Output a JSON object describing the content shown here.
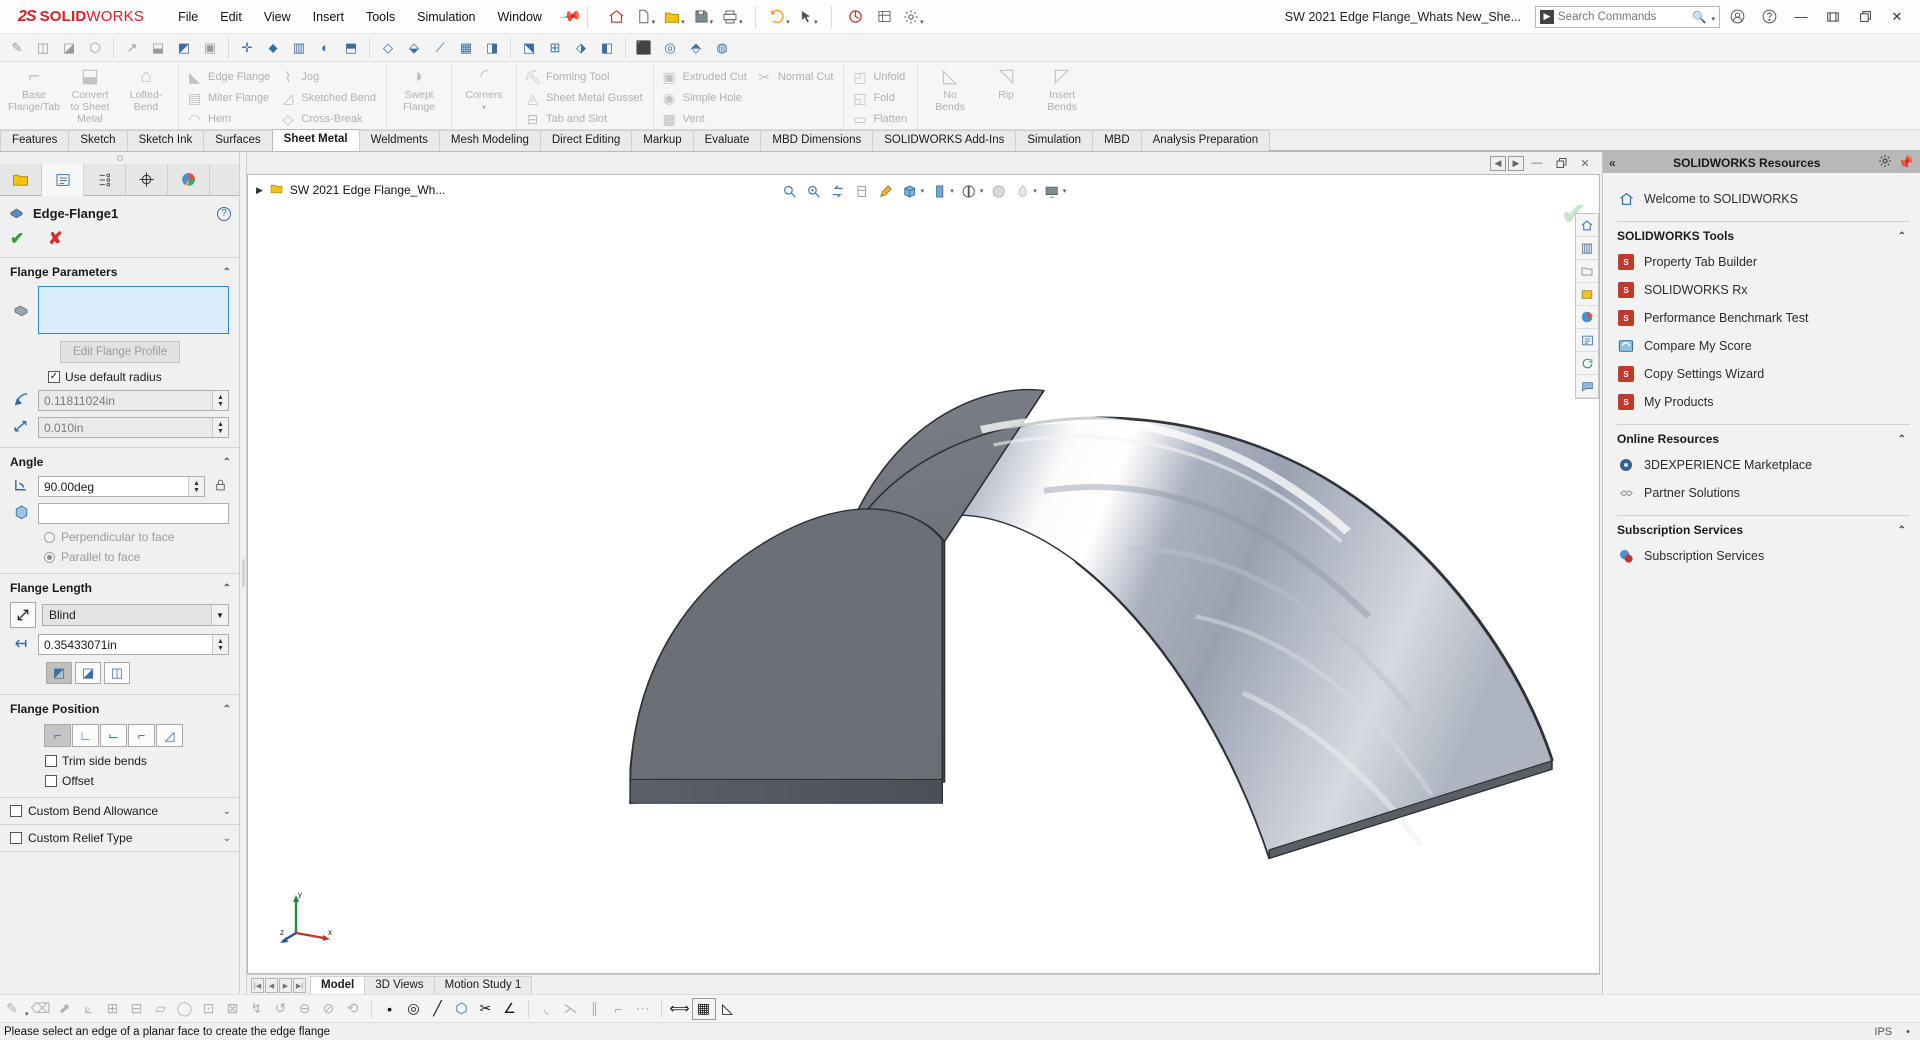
{
  "titlebar": {
    "brand_ds": "2S",
    "brand_solid": "SOLID",
    "brand_works": "WORKS",
    "menus": [
      "File",
      "Edit",
      "View",
      "Insert",
      "Tools",
      "Simulation",
      "Window"
    ],
    "doc_title": "SW 2021 Edge Flange_Whats New_She...",
    "search_placeholder": "Search Commands",
    "icons": [
      "home-icon",
      "new-doc-icon",
      "open-folder-icon",
      "save-icon",
      "print-icon",
      "undo-icon",
      "redo-icon",
      "select-icon",
      "rebuild-icon",
      "options-gear-icon"
    ]
  },
  "ribbon": {
    "groups": [
      {
        "name": "base-group",
        "big": [
          {
            "label": "Base\nFlange/Tab",
            "icon": "base-flange-icon"
          },
          {
            "label": "Convert\nto Sheet\nMetal",
            "icon": "convert-sheet-metal-icon"
          },
          {
            "label": "Lofted-Bend",
            "icon": "lofted-bend-icon"
          }
        ],
        "small": []
      },
      {
        "name": "flange-group",
        "big": [],
        "small": [
          "Edge Flange",
          "Miter Flange",
          "Hem"
        ]
      },
      {
        "name": "bend-group",
        "big": [],
        "small": [
          "Jog",
          "Sketched Bend",
          "Cross-Break"
        ]
      },
      {
        "name": "swept-group",
        "big": [
          {
            "label": "Swept\nFlange",
            "icon": "swept-flange-icon"
          }
        ],
        "small": []
      },
      {
        "name": "corners-group",
        "big": [
          {
            "label": "Corners",
            "icon": "corners-icon"
          }
        ],
        "small": []
      },
      {
        "name": "forming-group",
        "big": [],
        "small": [
          "Forming Tool",
          "Sheet Metal Gusset",
          "Tab and Slot"
        ]
      },
      {
        "name": "cut-group",
        "big": [],
        "small": [
          "Extruded Cut",
          "Simple Hole",
          "Vent"
        ]
      },
      {
        "name": "cut2-group",
        "big": [],
        "small": [
          "Normal Cut"
        ]
      },
      {
        "name": "unfold-group",
        "big": [],
        "small": [
          "Unfold",
          "Fold",
          "Flatten"
        ]
      },
      {
        "name": "bends-group",
        "big": [
          {
            "label": "No\nBends",
            "icon": "no-bends-icon"
          },
          {
            "label": "Rip",
            "icon": "rip-icon"
          },
          {
            "label": "Insert\nBends",
            "icon": "insert-bends-icon"
          }
        ],
        "small": []
      }
    ]
  },
  "tabs": {
    "items": [
      "Features",
      "Sketch",
      "Sketch Ink",
      "Surfaces",
      "Sheet Metal",
      "Weldments",
      "Mesh Modeling",
      "Direct Editing",
      "Markup",
      "Evaluate",
      "MBD Dimensions",
      "SOLIDWORKS Add-Ins",
      "Simulation",
      "MBD",
      "Analysis Preparation"
    ],
    "active": "Sheet Metal"
  },
  "property_manager": {
    "title": "Edge-Flange1",
    "icon": "edge-flange-icon",
    "sections": {
      "flange_parameters": {
        "heading": "Flange Parameters",
        "selection_value": "",
        "edit_profile_button": "Edit Flange Profile",
        "use_default_radius_label": "Use default radius",
        "use_default_radius_checked": true,
        "radius_value": "0.11811024in",
        "thickness_value": "0.010in"
      },
      "angle": {
        "heading": "Angle",
        "angle_value": "90.00deg",
        "reference_face_value": "",
        "perpendicular_label": "Perpendicular to face",
        "parallel_label": "Parallel to face",
        "selected_option": "Parallel to face"
      },
      "flange_length": {
        "heading": "Flange Length",
        "end_condition": "Blind",
        "length_value": "0.35433071in",
        "length_refs": [
          "outer-virtual-sharp-icon",
          "inner-virtual-sharp-icon",
          "tangent-bend-icon"
        ],
        "selected_ref_index": 0
      },
      "flange_position": {
        "heading": "Flange Position",
        "positions": [
          "material-inside-icon",
          "bend-outside-icon",
          "bend-from-virtual-sharp-icon",
          "tangent-to-bend-icon",
          "material-outside-icon"
        ],
        "selected_index": 0,
        "trim_side_bends_label": "Trim side bends",
        "trim_side_bends_checked": false,
        "offset_label": "Offset",
        "offset_checked": false
      },
      "custom_bend_allowance": {
        "label": "Custom Bend Allowance",
        "checked": false
      },
      "custom_relief_type": {
        "label": "Custom Relief Type",
        "checked": false
      }
    }
  },
  "graphics": {
    "breadcrumb": "SW 2021 Edge Flange_Wh...",
    "breadcrumb_icon": "folder-yellow-icon",
    "view_tools": [
      "zoom-to-fit-icon",
      "zoom-to-area-icon",
      "previous-view-icon",
      "section-view-icon",
      "view-orientation-icon",
      "display-style-icon",
      "hide-show-icon",
      "edit-appearance-icon",
      "apply-scene-icon",
      "view-settings-icon"
    ],
    "right_strip": [
      "view-home-icon",
      "hidden-lines-icon",
      "folder-icon",
      "display-manager-icon",
      "appearance-globe-icon",
      "scene-list-icon",
      "rotate-icon",
      "comment-icon"
    ],
    "confirm_ok": "✔",
    "confirm_cancel": "✘",
    "triad_labels": {
      "x": "x",
      "y": "y",
      "z": "z"
    }
  },
  "bottom": {
    "tabs": [
      "Model",
      "3D Views",
      "Motion Study 1"
    ],
    "active_tab": "Model",
    "status_icons_left": [
      "pencil-icon",
      "eraser-icon",
      "select-arrow-icon",
      "smart-dim-icon",
      "sketch1-icon",
      "sketch2-icon",
      "ruler-icon",
      "circle-icon",
      "plane1-icon",
      "plane2-icon",
      "curve1-icon",
      "curve2-icon",
      "revolve1-icon",
      "revolve2-icon",
      "mirror-icon"
    ],
    "status_icons_right": [
      "point-icon",
      "circle-tool-icon",
      "line-tool-icon",
      "polygon-icon",
      "trim-icon",
      "angle-icon",
      "arc-icon",
      "chamfer-icon",
      "parallel-icon",
      "corner-icon",
      "spline-icon",
      "dimension-icon",
      "grid-icon",
      "triangle-icon"
    ],
    "active_right_index": 12
  },
  "statusbar": {
    "message": "Please select an edge of a planar face to create the edge flange",
    "units": "IPS",
    "right_extra": "•"
  },
  "resources": {
    "title": "SOLIDWORKS Resources",
    "welcome": {
      "label": "Welcome to SOLIDWORKS",
      "icon": "home-icon"
    },
    "sections": [
      {
        "heading": "SOLIDWORKS Tools",
        "items": [
          {
            "label": "Property Tab Builder",
            "icon": "sw-cube-icon"
          },
          {
            "label": "SOLIDWORKS Rx",
            "icon": "sw-rx-icon"
          },
          {
            "label": "Performance Benchmark Test",
            "icon": "sw-rx-icon"
          },
          {
            "label": "Compare My Score",
            "icon": "compare-score-icon"
          },
          {
            "label": "Copy Settings Wizard",
            "icon": "copy-settings-icon"
          },
          {
            "label": "My Products",
            "icon": "my-products-icon"
          }
        ]
      },
      {
        "heading": "Online Resources",
        "items": [
          {
            "label": "3DEXPERIENCE Marketplace",
            "icon": "marketplace-icon"
          },
          {
            "label": "Partner Solutions",
            "icon": "handshake-icon"
          }
        ]
      },
      {
        "heading": "Subscription Services",
        "items": [
          {
            "label": "Subscription Services",
            "icon": "subscription-globe-icon"
          }
        ]
      }
    ]
  }
}
